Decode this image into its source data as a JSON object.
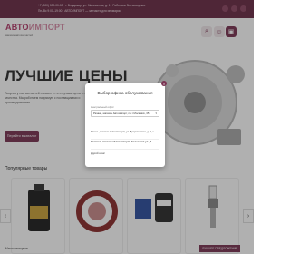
{
  "topbar": {
    "line1": "+7 (000) 000-00-00 · г. Владимир, ул. Магазинная, д. 1 · Работаем без выходных",
    "line2": "Пн–Вс 9:00–19:00 · АВТОИМПОРТ — запчасти для иномарок"
  },
  "header": {
    "logo_main": "АВТО",
    "logo_accent": "ИМПОРТ",
    "logo_sub": "магазин автозапчастей"
  },
  "hero": {
    "title": "ЛУЧШИЕ ЦЕНЫ",
    "text": "Покупка у нас запчастей и масел — это лучшая цена и гарантия качества. Мы работаем напрямую с поставщиками и производителями.",
    "button": "Перейти в каталог"
  },
  "section": {
    "title": "Популярные товары"
  },
  "footer": {
    "brand_label": "Масло моторное",
    "brand_badge": "ЛУЧШЕЕ ПРЕДЛОЖЕНИЕ"
  },
  "modal": {
    "title": "Выбор офиса обслуживания",
    "label": "Центральный офис:",
    "selected": "Рязань, магазин Автоимпорт, пр-т Московск, 35",
    "close": "×",
    "items": [
      {
        "text": "Рязань, магазин \"Автоимпорт\", ул. Дзержинского, д. 9, к",
        "bold": false
      },
      {
        "text": "Касимов, магазин \"Автоимпорт\", Солнечная ул., 4",
        "bold": true
      },
      {
        "text": "Другой офис",
        "bold": false
      }
    ]
  },
  "colors": {
    "brand": "#7a3452",
    "topbar": "#6b2c46"
  }
}
